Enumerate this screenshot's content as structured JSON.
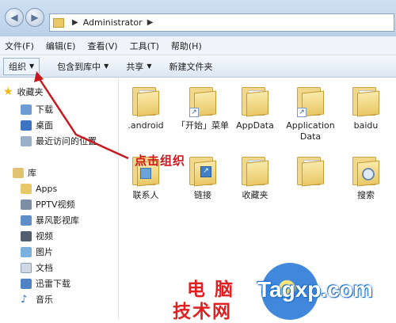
{
  "window": {
    "address_path": "Administrator"
  },
  "menubar": {
    "items": [
      "文件(F)",
      "编辑(E)",
      "查看(V)",
      "工具(T)",
      "帮助(H)"
    ]
  },
  "toolbar": {
    "organize": "组织",
    "include_in_library": "包含到库中",
    "share": "共享",
    "new_folder": "新建文件夹"
  },
  "sidebar": {
    "favorites": {
      "label": "收藏夹",
      "items": [
        "下载",
        "桌面",
        "最近访问的位置"
      ]
    },
    "libraries": {
      "label": "库",
      "items": [
        "Apps",
        "PPTV视频",
        "暴风影视库",
        "视频",
        "图片",
        "文档",
        "迅雷下载",
        "音乐"
      ]
    }
  },
  "files": [
    {
      "name": ".android",
      "shortcut": false
    },
    {
      "name": "「开始」菜单",
      "shortcut": true
    },
    {
      "name": "AppData",
      "shortcut": false
    },
    {
      "name": "Application Data",
      "shortcut": true
    },
    {
      "name": "baidu",
      "shortcut": false
    },
    {
      "name": "联系人",
      "shortcut": false
    },
    {
      "name": "链接",
      "shortcut": false
    },
    {
      "name": "收藏夹",
      "shortcut": false
    },
    {
      "name": "",
      "shortcut": false
    },
    {
      "name": "搜索",
      "shortcut": false
    }
  ],
  "annotation": {
    "text": "点击组织",
    "color": "#d4151c"
  },
  "watermark": {
    "line1": "电 脑",
    "line2": "技术网",
    "brand": "Tagxp.com"
  }
}
